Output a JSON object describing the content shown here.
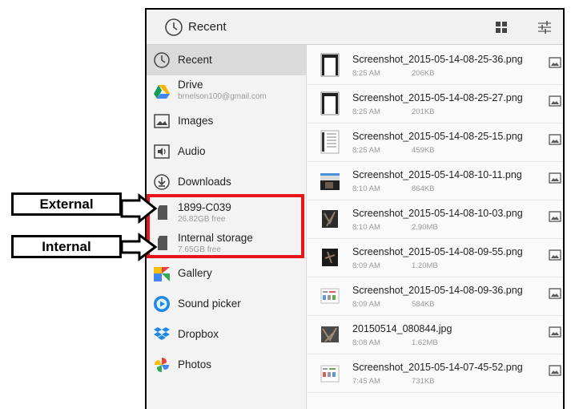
{
  "topbar": {
    "title": "Recent"
  },
  "sidebar": {
    "items": [
      {
        "label": "Recent",
        "icon": "clock-icon",
        "active": true
      },
      {
        "label": "Drive",
        "sub": "brnelson100@gmail.com",
        "icon": "drive-icon"
      },
      {
        "label": "Images",
        "icon": "image-icon"
      },
      {
        "label": "Audio",
        "icon": "audio-icon"
      },
      {
        "label": "Downloads",
        "icon": "download-icon"
      },
      {
        "label": "1899-C039",
        "sub": "26.82GB free",
        "icon": "sd-card-icon"
      },
      {
        "label": "Internal storage",
        "sub": "7.65GB free",
        "icon": "sd-card-icon"
      },
      {
        "label": "Gallery",
        "icon": "gallery-icon"
      },
      {
        "label": "Sound picker",
        "icon": "sound-picker-icon"
      },
      {
        "label": "Dropbox",
        "icon": "dropbox-icon"
      },
      {
        "label": "Photos",
        "icon": "photos-icon"
      }
    ]
  },
  "files": [
    {
      "name": "Screenshot_2015-05-14-08-25-36.png",
      "time": "8:25 AM",
      "size": "206KB"
    },
    {
      "name": "Screenshot_2015-05-14-08-25-27.png",
      "time": "8:25 AM",
      "size": "201KB"
    },
    {
      "name": "Screenshot_2015-05-14-08-25-15.png",
      "time": "8:25 AM",
      "size": "459KB"
    },
    {
      "name": "Screenshot_2015-05-14-08-10-11.png",
      "time": "8:10 AM",
      "size": "864KB"
    },
    {
      "name": "Screenshot_2015-05-14-08-10-03.png",
      "time": "8:10 AM",
      "size": "2.90MB"
    },
    {
      "name": "Screenshot_2015-05-14-08-09-55.png",
      "time": "8:09 AM",
      "size": "1.20MB"
    },
    {
      "name": "Screenshot_2015-05-14-08-09-36.png",
      "time": "8:09 AM",
      "size": "584KB"
    },
    {
      "name": "20150514_080844.jpg",
      "time": "8:08 AM",
      "size": "1.62MB"
    },
    {
      "name": "Screenshot_2015-05-14-07-45-52.png",
      "time": "7:45 AM",
      "size": "731KB"
    }
  ],
  "annotations": {
    "external": "External",
    "internal": "Internal",
    "highlight_color": "#e8141a"
  }
}
